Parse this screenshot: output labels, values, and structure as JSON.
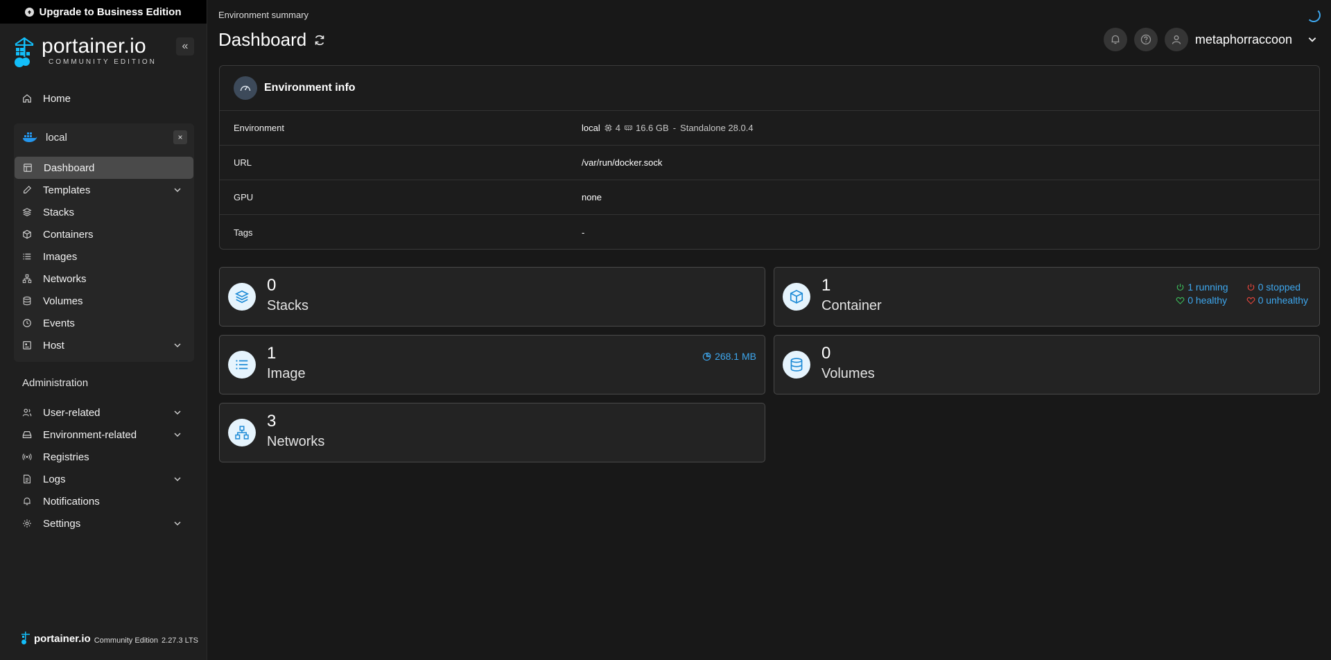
{
  "upgrade_banner": {
    "label": "Upgrade to Business Edition"
  },
  "brand": {
    "name": "portainer.io",
    "edition": "COMMUNITY EDITION"
  },
  "sidebar": {
    "home": "Home",
    "environment": {
      "name": "local",
      "items": [
        {
          "label": "Dashboard"
        },
        {
          "label": "Templates"
        },
        {
          "label": "Stacks"
        },
        {
          "label": "Containers"
        },
        {
          "label": "Images"
        },
        {
          "label": "Networks"
        },
        {
          "label": "Volumes"
        },
        {
          "label": "Events"
        },
        {
          "label": "Host"
        }
      ]
    },
    "admin_heading": "Administration",
    "admin_items": [
      {
        "label": "User-related"
      },
      {
        "label": "Environment-related"
      },
      {
        "label": "Registries"
      },
      {
        "label": "Logs"
      },
      {
        "label": "Notifications"
      },
      {
        "label": "Settings"
      }
    ],
    "footer": {
      "brand": "portainer.io",
      "edition": "Community Edition",
      "version": "2.27.3 LTS"
    }
  },
  "header": {
    "breadcrumb": "Environment summary",
    "title": "Dashboard",
    "username": "metaphorraccoon"
  },
  "env_info": {
    "title": "Environment info",
    "rows": {
      "environment": {
        "key": "Environment",
        "name": "local",
        "cpu": "4",
        "memory": "16.6 GB",
        "separator": "-",
        "engine": "Standalone 28.0.4"
      },
      "url": {
        "key": "URL",
        "value": "/var/run/docker.sock"
      },
      "gpu": {
        "key": "GPU",
        "value": "none"
      },
      "tags": {
        "key": "Tags",
        "value": "-"
      }
    }
  },
  "stats": {
    "stacks": {
      "count": "0",
      "label": "Stacks"
    },
    "containers": {
      "count": "1",
      "label": "Container",
      "running": "1 running",
      "stopped": "0 stopped",
      "healthy": "0 healthy",
      "unhealthy": "0 unhealthy"
    },
    "images": {
      "count": "1",
      "label": "Image",
      "size": "268.1 MB"
    },
    "volumes": {
      "count": "0",
      "label": "Volumes"
    },
    "networks": {
      "count": "3",
      "label": "Networks"
    }
  },
  "colors": {
    "accent": "#3ea7ee",
    "running": "#3cb95a",
    "stopped": "#e2453c",
    "background": "#181818"
  }
}
